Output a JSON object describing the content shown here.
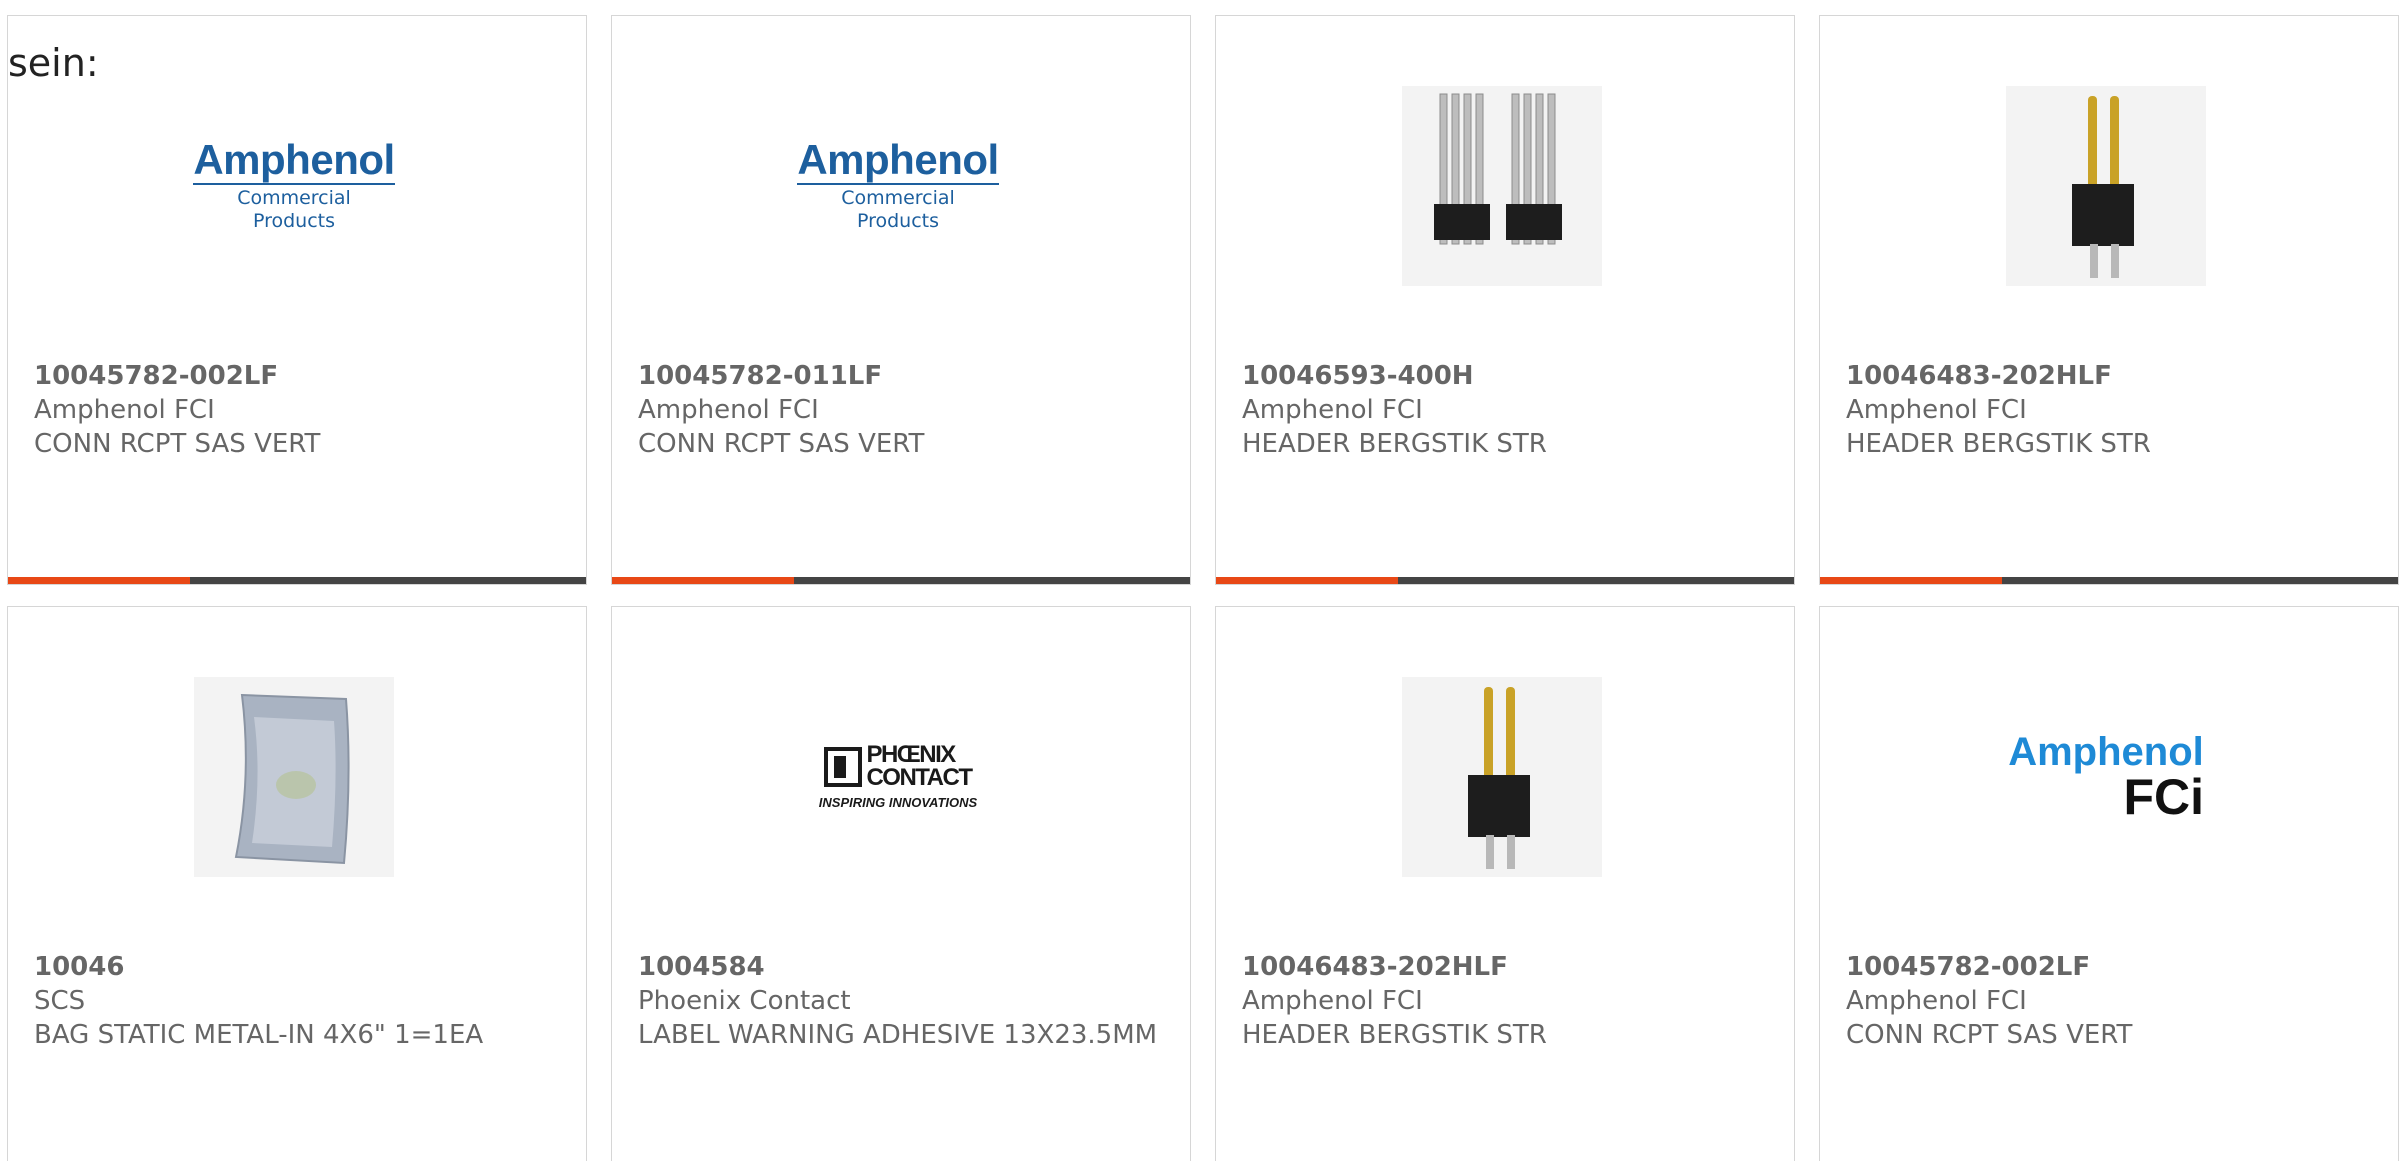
{
  "intro": {
    "text": "sein:"
  },
  "colors": {
    "accent": "#e84816",
    "bar": "#444444",
    "text": "#666666",
    "border": "#d6d6d6"
  },
  "products": [
    {
      "part_number": "10045782-002LF",
      "manufacturer": "Amphenol FCI",
      "description": "CONN RCPT SAS VERT",
      "image": {
        "kind": "logo-amphenol-commercial",
        "line1": "Amphenol",
        "line2": "Commercial Products"
      }
    },
    {
      "part_number": "10045782-011LF",
      "manufacturer": "Amphenol FCI",
      "description": "CONN RCPT SAS VERT",
      "image": {
        "kind": "logo-amphenol-commercial",
        "line1": "Amphenol",
        "line2": "Commercial Products"
      }
    },
    {
      "part_number": "10046593-400H",
      "manufacturer": "Amphenol FCI",
      "description": "HEADER BERGSTIK STR",
      "image": {
        "kind": "photo-header-silver"
      }
    },
    {
      "part_number": "10046483-202HLF",
      "manufacturer": "Amphenol FCI",
      "description": "HEADER BERGSTIK STR",
      "image": {
        "kind": "photo-header-gold"
      }
    },
    {
      "part_number": "10046",
      "manufacturer": "SCS",
      "description": "BAG STATIC METAL-IN 4X6\" 1=1EA",
      "image": {
        "kind": "photo-static-bag"
      }
    },
    {
      "part_number": "1004584",
      "manufacturer": "Phoenix Contact",
      "description": "LABEL WARNING ADHESIVE 13X23.5MM",
      "image": {
        "kind": "logo-phoenix",
        "line1": "PHŒNIX",
        "line2": "CONTACT",
        "tagline": "INSPIRING INNOVATIONS"
      }
    },
    {
      "part_number": "10046483-202HLF",
      "manufacturer": "Amphenol FCI",
      "description": "HEADER BERGSTIK STR",
      "image": {
        "kind": "photo-header-gold"
      }
    },
    {
      "part_number": "10045782-002LF",
      "manufacturer": "Amphenol FCI",
      "description": "CONN RCPT SAS VERT",
      "image": {
        "kind": "logo-amphenol-fci",
        "line1": "Amphenol",
        "line2": "FCi"
      }
    }
  ]
}
